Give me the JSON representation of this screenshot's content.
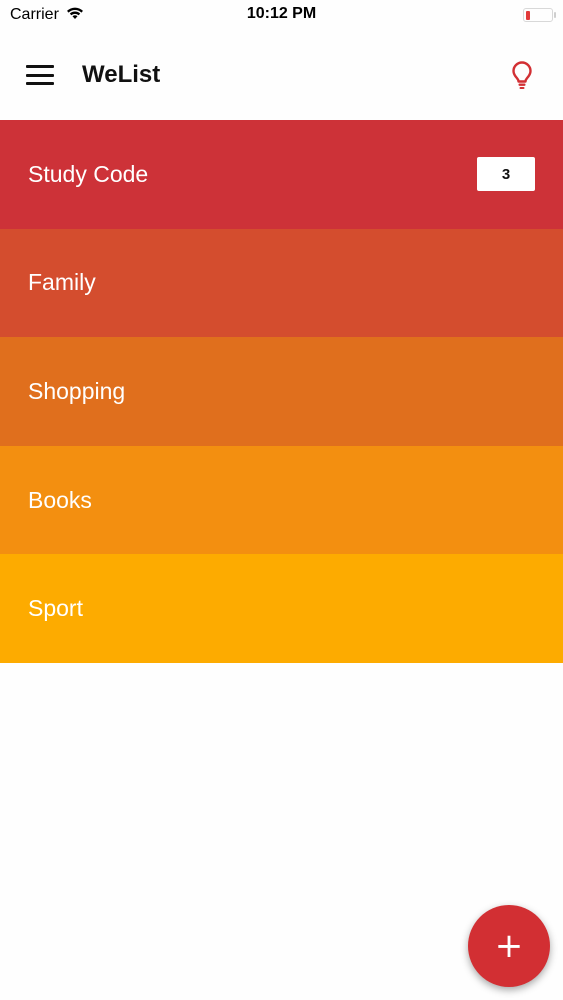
{
  "status_bar": {
    "carrier": "Carrier",
    "time": "10:12 PM",
    "battery_level": 0.15
  },
  "app_bar": {
    "title": "WeList",
    "menu_icon": "hamburger-menu-icon",
    "action_icon": "lightbulb-icon"
  },
  "lists": [
    {
      "label": "Study Code",
      "count": "3",
      "color": "#cd3238"
    },
    {
      "label": "Family",
      "color": "#d44d2e"
    },
    {
      "label": "Shopping",
      "color": "#e06f1d"
    },
    {
      "label": "Books",
      "color": "#f38f10"
    },
    {
      "label": "Sport",
      "color": "#fdab00"
    }
  ],
  "fab": {
    "icon": "plus-icon",
    "symbol": "+",
    "color": "#d22f33"
  },
  "colors": {
    "accent": "#d22f33"
  }
}
